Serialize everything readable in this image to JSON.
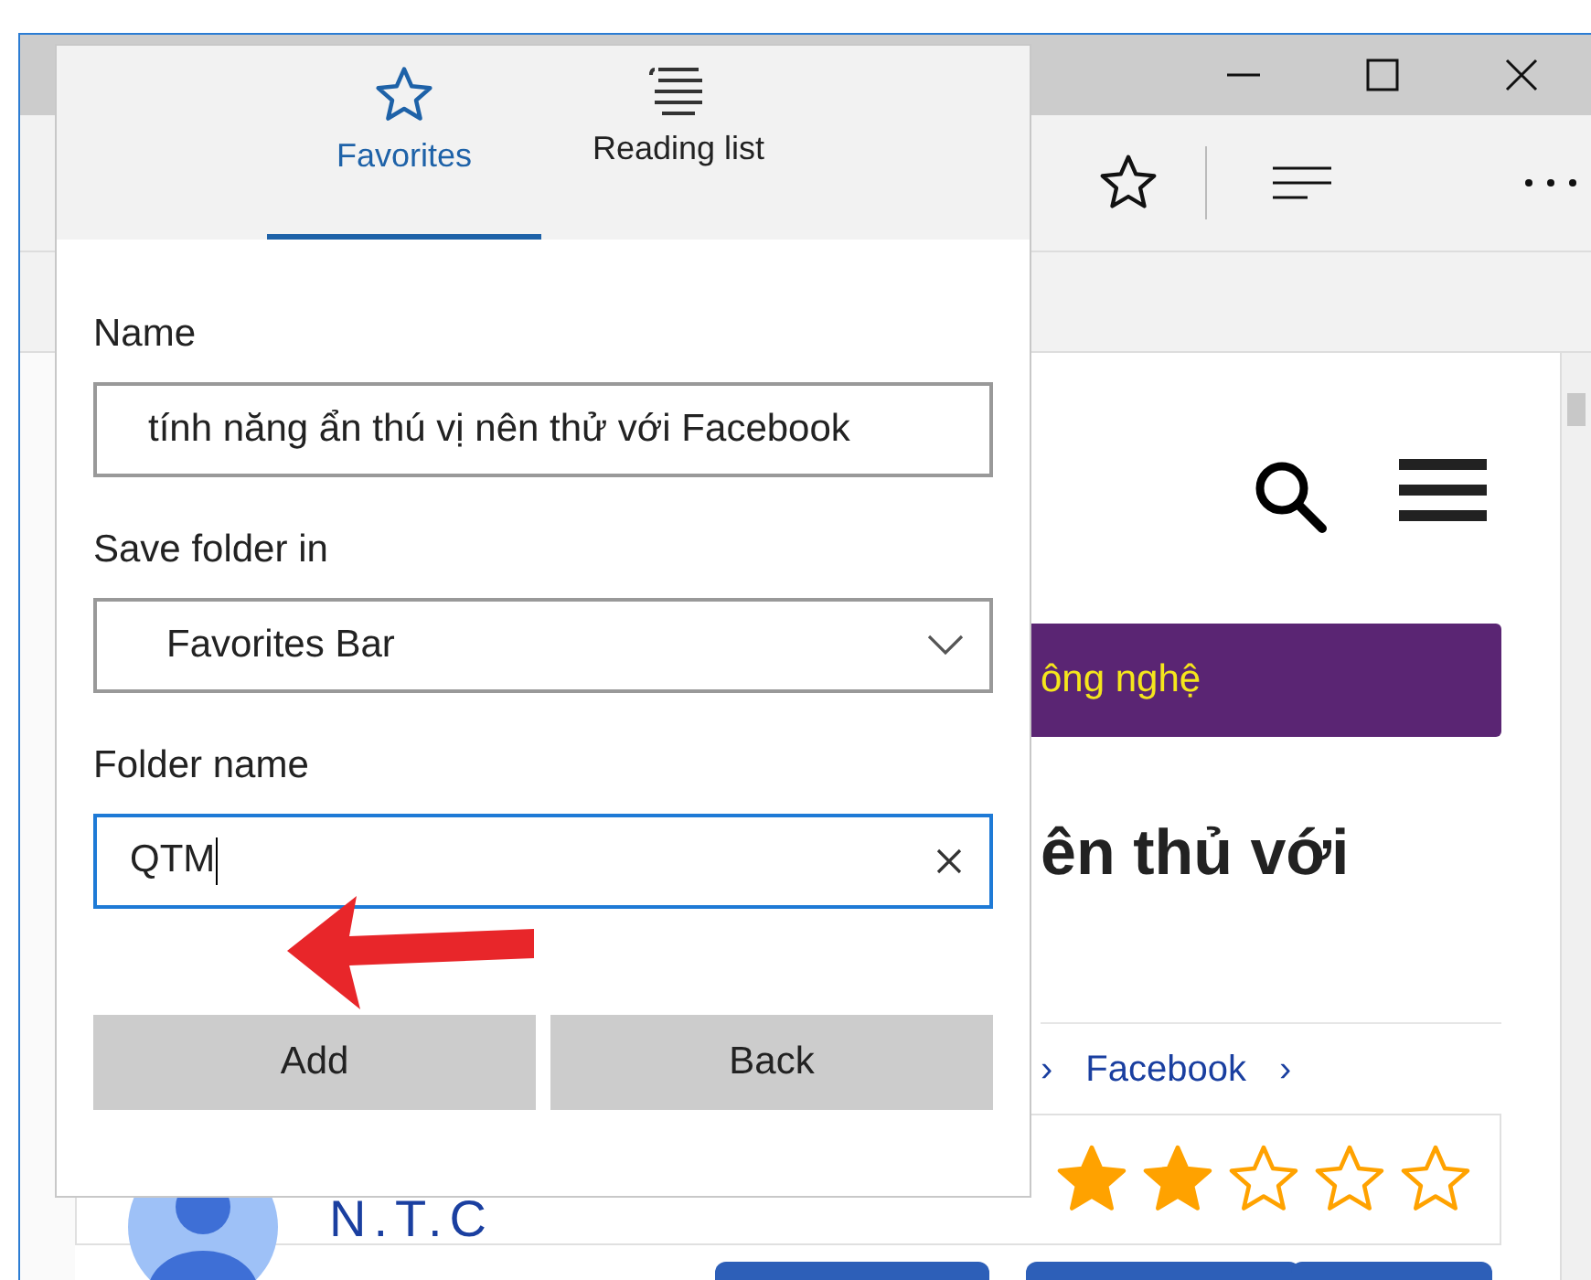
{
  "page": {
    "banner": "ông nghệ",
    "heading": "ên thủ với",
    "breadcrumb": [
      "›",
      "Facebook",
      "›"
    ],
    "rating": {
      "stars": 2
    },
    "author": "N.T.C"
  },
  "popup": {
    "tabs": [
      {
        "label": "Favorites",
        "selected": true
      },
      {
        "label": "Reading list",
        "selected": false
      }
    ],
    "fields": [
      {
        "kind": "text",
        "label": "Name",
        "value": "tính năng ẩn thú vị nên thử với Facebook"
      },
      {
        "kind": "select",
        "label": "Save folder in",
        "value": "Favorites Bar"
      },
      {
        "kind": "text",
        "label": "Folder name",
        "value": "QTM",
        "focused": true
      }
    ],
    "buttons": [
      "Add",
      "Back"
    ]
  }
}
